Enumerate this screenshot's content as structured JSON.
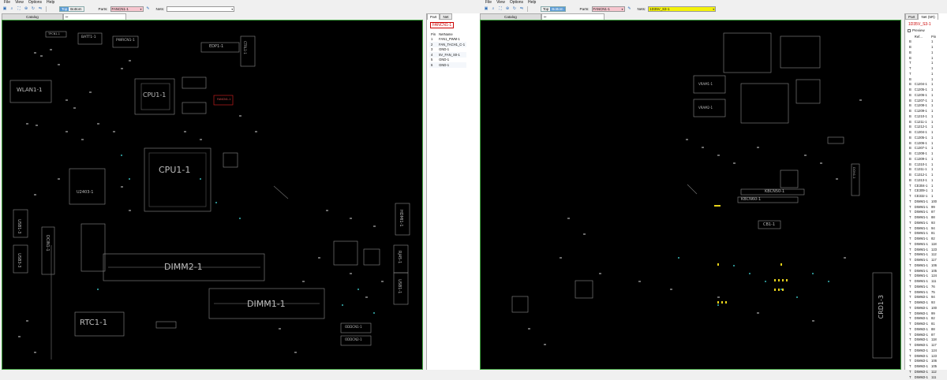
{
  "menu": [
    "File",
    "View",
    "Options",
    "Help"
  ],
  "toolbar_icons": [
    "open-icon",
    "search-icon",
    "fit-icon",
    "zoom-in-icon",
    "rotate-icon",
    "flip-icon"
  ],
  "left": {
    "side_toggle": {
      "top": "Top",
      "bottom": "Bottom",
      "active": "Top"
    },
    "parts_label": "Parts:",
    "parts_value": "FANCN1-1",
    "nets_label": "Nets:",
    "nets_value": "",
    "tab_catalog": "Catalog",
    "panel_tabs": [
      "Part",
      "Net"
    ],
    "selected_part": "FANCN1-1",
    "pin_headers": [
      "Pin",
      "NetName"
    ],
    "pins": [
      {
        "pin": "1",
        "net": "FAN1_PWM-1"
      },
      {
        "pin": "2",
        "net": "FAN_TACH1_C-1"
      },
      {
        "pin": "3",
        "net": "GND-1"
      },
      {
        "pin": "4",
        "net": "5V_FAN_S0-1"
      },
      {
        "pin": "5",
        "net": "GND-1"
      },
      {
        "pin": "6",
        "net": "GND-1"
      }
    ],
    "board_labels": {
      "cpu_small": "CPU1-1",
      "cpu_large": "CPU1-1",
      "wlan": "WLAN1-1",
      "dimm2": "DIMM2-1",
      "dimm1": "DIMM1-1",
      "rtc": "RTC1-1",
      "edp": "EDP1-1",
      "u2403": "U2403-1",
      "usb1": "USB1-3",
      "usb3": "USB3-3",
      "docn": "DCIN1-1",
      "hdmi": "HDMI1-1",
      "rj45": "RJ45-1",
      "usb1b": "USB1-1",
      "batt": "BATT1-1",
      "pwrcn": "PWRCN1-1",
      "tpcn": "TPCN1-1",
      "fancn": "FANCN1-1",
      "ctrl": "CTRL1-1",
      "oddcn": "ODDCN1-1",
      "oddcn2": "ODDCN2-1"
    }
  },
  "right": {
    "side_toggle": {
      "top": "Top",
      "bottom": "Bottom",
      "active": "Bottom"
    },
    "parts_label": "Parts:",
    "parts_value": "FANCN1-1",
    "nets_label": "Nets:",
    "nets_value": "1D35V_S3-1",
    "tab_catalog": "Catalog",
    "panel_tabs": [
      "Part",
      "Net (5R)"
    ],
    "selected_net": "1D35V_S3-1",
    "preview_label": "Preview",
    "ref_headers": [
      "",
      "Ref...",
      "Pin"
    ],
    "refs": [
      [
        "B",
        "",
        "1"
      ],
      [
        "B",
        "",
        "1"
      ],
      [
        "B",
        "",
        "1"
      ],
      [
        "B",
        "",
        "1"
      ],
      [
        "T",
        "",
        "1"
      ],
      [
        "T",
        "",
        "1"
      ],
      [
        "T",
        "",
        "1"
      ],
      [
        "B",
        "",
        "1"
      ],
      [
        "B",
        "C1204-1",
        "1"
      ],
      [
        "B",
        "C1205-1",
        "1"
      ],
      [
        "B",
        "C1206-1",
        "1"
      ],
      [
        "B",
        "C1207-1",
        "1"
      ],
      [
        "B",
        "C1208-1",
        "1"
      ],
      [
        "B",
        "C1209-1",
        "1"
      ],
      [
        "B",
        "C1210-1",
        "1"
      ],
      [
        "B",
        "C1211-1",
        "1"
      ],
      [
        "B",
        "C1212-1",
        "1"
      ],
      [
        "B",
        "C1304-1",
        "1"
      ],
      [
        "B",
        "C1305-1",
        "1"
      ],
      [
        "B",
        "C1306-1",
        "1"
      ],
      [
        "B",
        "C1307-1",
        "1"
      ],
      [
        "B",
        "C1308-1",
        "1"
      ],
      [
        "B",
        "C1309-1",
        "1"
      ],
      [
        "B",
        "C1310-1",
        "1"
      ],
      [
        "B",
        "C1311-1",
        "1"
      ],
      [
        "B",
        "C1312-1",
        "1"
      ],
      [
        "B",
        "C1313-1",
        "1"
      ],
      [
        "T",
        "CE304-1",
        "1"
      ],
      [
        "T",
        "CE309-1",
        "1"
      ],
      [
        "T",
        "CE332-1",
        "1"
      ],
      [
        "T",
        "DIMM1-1",
        "100"
      ],
      [
        "T",
        "DIMM1-1",
        "99"
      ],
      [
        "T",
        "DIMM1-1",
        "87"
      ],
      [
        "T",
        "DIMM1-1",
        "88"
      ],
      [
        "T",
        "DIMM1-1",
        "93"
      ],
      [
        "T",
        "DIMM1-1",
        "94"
      ],
      [
        "T",
        "DIMM1-1",
        "81"
      ],
      [
        "T",
        "DIMM1-1",
        "82"
      ],
      [
        "T",
        "DIMM1-1",
        "118"
      ],
      [
        "T",
        "DIMM1-1",
        "123"
      ],
      [
        "T",
        "DIMM1-1",
        "112"
      ],
      [
        "T",
        "DIMM1-1",
        "117"
      ],
      [
        "T",
        "DIMM1-1",
        "106"
      ],
      [
        "T",
        "DIMM1-1",
        "105"
      ],
      [
        "T",
        "DIMM1-1",
        "124"
      ],
      [
        "T",
        "DIMM1-1",
        "111"
      ],
      [
        "T",
        "DIMM1-1",
        "76"
      ],
      [
        "T",
        "DIMM1-1",
        "75"
      ],
      [
        "T",
        "DIMM2-1",
        "94"
      ],
      [
        "T",
        "DIMM2-1",
        "93"
      ],
      [
        "T",
        "DIMM2-1",
        "100"
      ],
      [
        "T",
        "DIMM2-1",
        "99"
      ],
      [
        "T",
        "DIMM2-1",
        "82"
      ],
      [
        "T",
        "DIMM2-1",
        "81"
      ],
      [
        "T",
        "DIMM2-1",
        "88"
      ],
      [
        "T",
        "DIMM2-1",
        "87"
      ],
      [
        "T",
        "DIMM2-1",
        "118"
      ],
      [
        "T",
        "DIMM2-1",
        "117"
      ],
      [
        "T",
        "DIMM2-1",
        "124"
      ],
      [
        "T",
        "DIMM2-1",
        "123"
      ],
      [
        "T",
        "DIMM2-1",
        "106"
      ],
      [
        "T",
        "DIMM2-1",
        "105"
      ],
      [
        "T",
        "DIMM2-1",
        "112"
      ],
      [
        "T",
        "DIMM2-1",
        "111"
      ]
    ],
    "board_labels": {
      "crd": "CRD1-3",
      "kbcn": "KBCN50-1",
      "kbcn2": "KBCN60-1",
      "cb1": "CB1-1",
      "vram1": "VRAM1-1",
      "vram2": "VRAM2-1",
      "docn": "DCIN1-1"
    }
  },
  "colors": {
    "board_bg": "#000000",
    "board_border": "#3fa33f",
    "highlight_pink": "#f7c6cf",
    "highlight_yellow": "#f4f20a",
    "selected_red": "#cc0000",
    "side_active": "#5b9bd5"
  }
}
